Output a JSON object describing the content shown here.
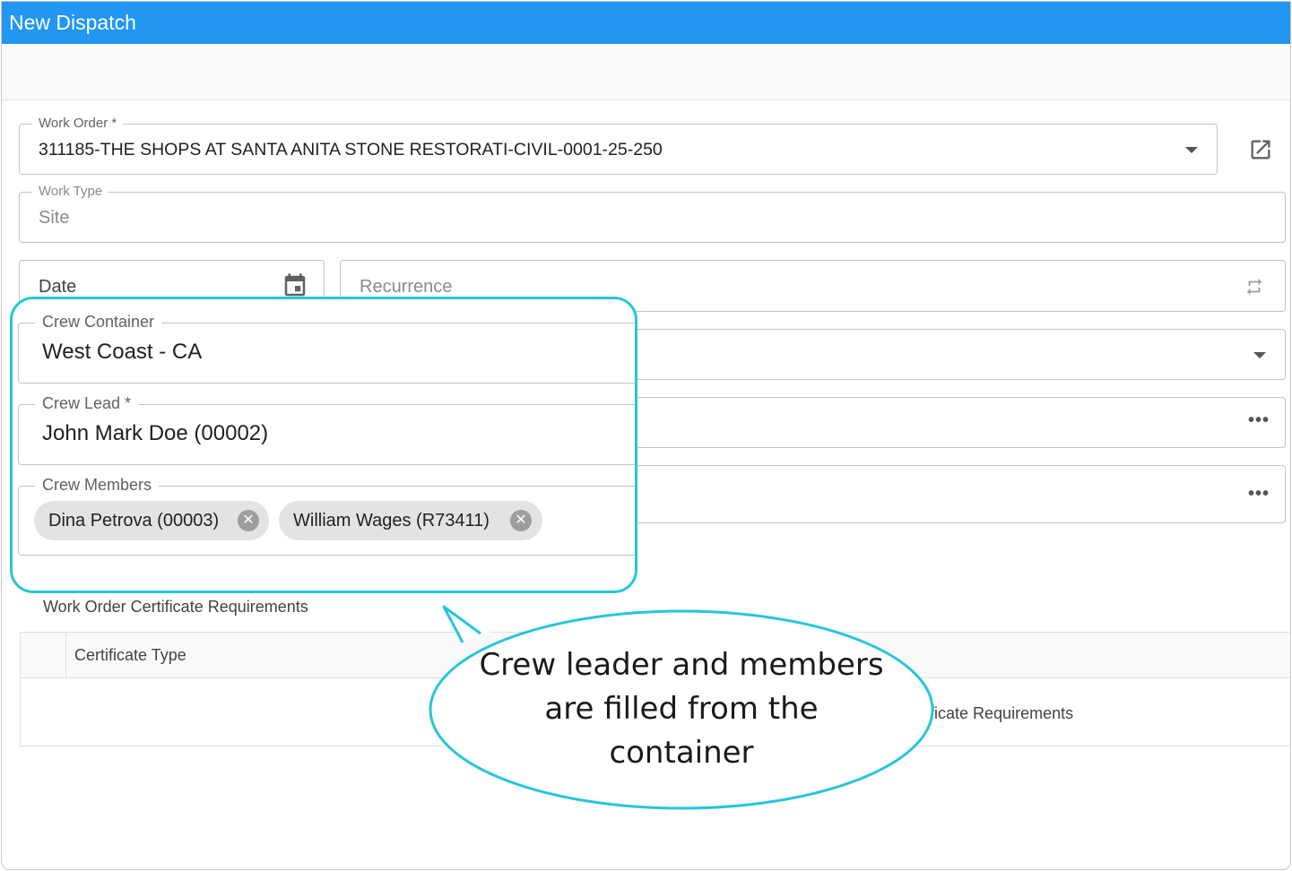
{
  "window": {
    "title": "New Dispatch"
  },
  "form": {
    "work_order": {
      "label": "Work Order *",
      "value": "311185-THE SHOPS AT SANTA ANITA STONE RESTORATI-CIVIL-0001-25-250"
    },
    "work_type": {
      "label": "Work Type",
      "value": "Site"
    },
    "date": {
      "placeholder": "Date"
    },
    "recurrence": {
      "placeholder": "Recurrence"
    }
  },
  "callout": {
    "crew_container": {
      "label": "Crew Container",
      "value": "West Coast - CA"
    },
    "crew_lead": {
      "label": "Crew Lead *",
      "value": "John Mark Doe (00002)"
    },
    "crew_members": {
      "label": "Crew Members",
      "chips": [
        "Dina Petrova (00003)",
        "William Wages (R73411)"
      ]
    },
    "bubble_lines": [
      "Crew leader and members",
      "are filled from the",
      "container"
    ]
  },
  "certificates": {
    "title": "Work Order Certificate Requirements",
    "columns": [
      "Certificate Type"
    ],
    "empty_text": "No Certificate Requirements"
  },
  "icons": {
    "open_link": "open-in-new-icon",
    "calendar": "calendar-icon",
    "repeat": "repeat-icon",
    "dropdown": "chevron-down-icon",
    "more": "more-horizontal-icon",
    "remove_chip": "close-circle-icon"
  },
  "colors": {
    "titlebar": "#2196f3",
    "callout_border": "#26c6da"
  }
}
